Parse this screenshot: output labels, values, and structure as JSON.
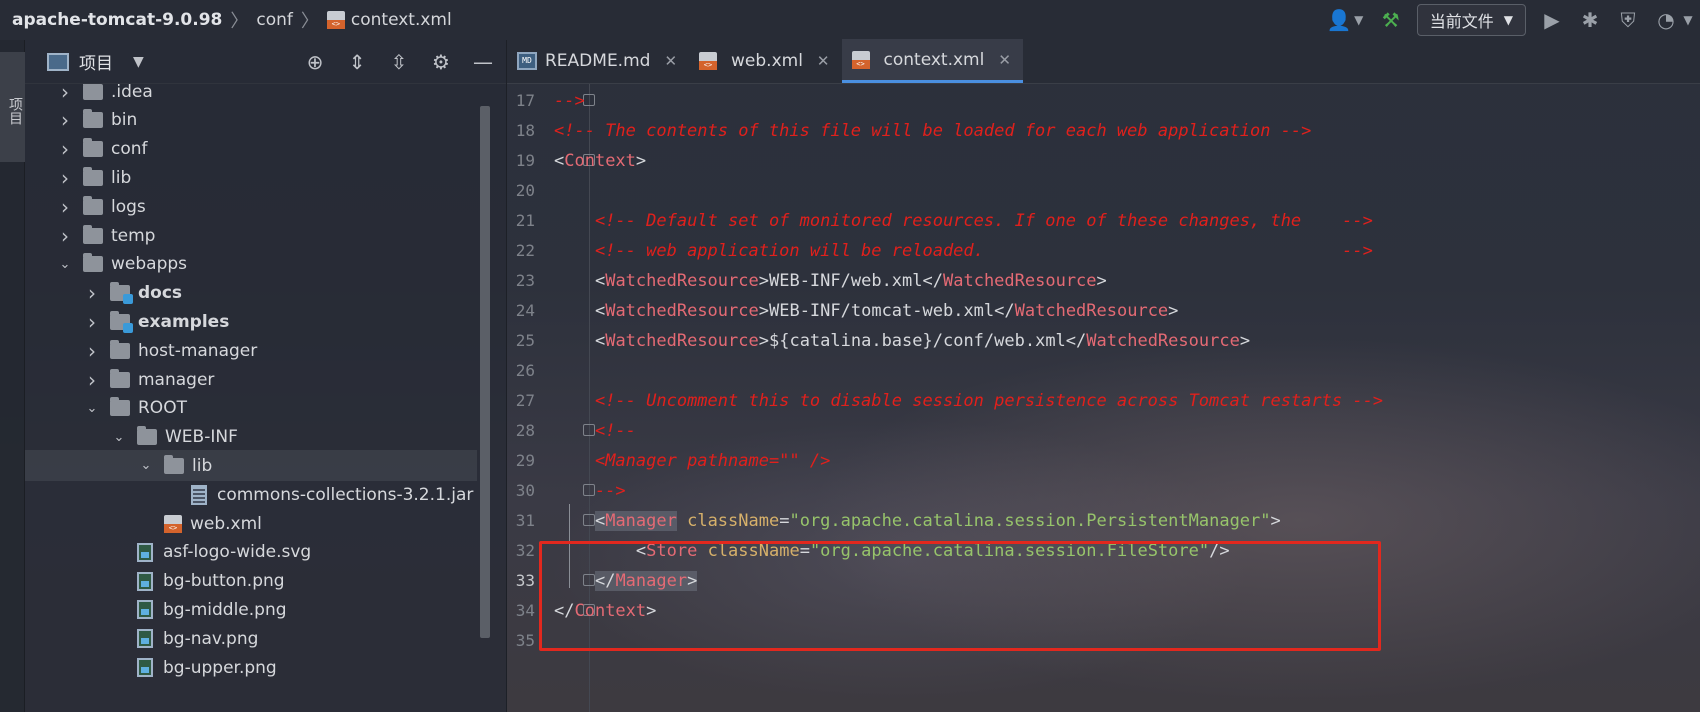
{
  "breadcrumb": {
    "project": "apache-tomcat-9.0.98",
    "folder": "conf",
    "file": "context.xml"
  },
  "toolbar": {
    "run_config": "当前文件",
    "icons": [
      "user-icon",
      "build-hammer-icon",
      "run-icon",
      "debug-icon",
      "coverage-icon",
      "profile-icon"
    ]
  },
  "left_strip": {
    "label": "项目"
  },
  "project_panel": {
    "title": "项目"
  },
  "tree": [
    {
      "label": ".idea",
      "type": "folder",
      "expanded": false,
      "bold": false
    },
    {
      "label": "bin",
      "type": "folder",
      "expanded": false,
      "bold": false
    },
    {
      "label": "conf",
      "type": "folder",
      "expanded": false,
      "bold": false
    },
    {
      "label": "lib",
      "type": "folder",
      "expanded": false,
      "bold": false
    },
    {
      "label": "logs",
      "type": "folder",
      "expanded": false,
      "bold": false
    },
    {
      "label": "temp",
      "type": "folder",
      "expanded": false,
      "bold": false
    },
    {
      "label": "webapps",
      "type": "folder",
      "expanded": true,
      "bold": false
    },
    {
      "label": "docs",
      "type": "module-folder",
      "expanded": false,
      "bold": true
    },
    {
      "label": "examples",
      "type": "module-folder",
      "expanded": false,
      "bold": true
    },
    {
      "label": "host-manager",
      "type": "folder",
      "expanded": false,
      "bold": false
    },
    {
      "label": "manager",
      "type": "folder",
      "expanded": false,
      "bold": false
    },
    {
      "label": "ROOT",
      "type": "folder",
      "expanded": true,
      "bold": false
    },
    {
      "label": "WEB-INF",
      "type": "folder",
      "expanded": true,
      "bold": false
    },
    {
      "label": "lib",
      "type": "folder",
      "expanded": true,
      "bold": false
    },
    {
      "label": "commons-collections-3.2.1.jar",
      "type": "jar",
      "bold": false
    },
    {
      "label": "web.xml",
      "type": "xml",
      "bold": false
    },
    {
      "label": "asf-logo-wide.svg",
      "type": "image",
      "bold": false
    },
    {
      "label": "bg-button.png",
      "type": "image",
      "bold": false
    },
    {
      "label": "bg-middle.png",
      "type": "image",
      "bold": false
    },
    {
      "label": "bg-nav.png",
      "type": "image",
      "bold": false
    },
    {
      "label": "bg-upper.png",
      "type": "image",
      "bold": false
    }
  ],
  "tabs": [
    {
      "label": "README.md",
      "active": false
    },
    {
      "label": "web.xml",
      "active": false
    },
    {
      "label": "context.xml",
      "active": true
    }
  ],
  "code": {
    "current_line": 33,
    "lines": [
      {
        "n": 17,
        "text": "-->"
      },
      {
        "n": 18,
        "text": "<!-- The contents of this file will be loaded for each web application -->"
      },
      {
        "n": 19,
        "text": "<Context>"
      },
      {
        "n": 20,
        "text": ""
      },
      {
        "n": 21,
        "text": "    <!-- Default set of monitored resources. If one of these changes, the    -->"
      },
      {
        "n": 22,
        "text": "    <!-- web application will be reloaded.                                   -->"
      },
      {
        "n": 23,
        "text": "    <WatchedResource>WEB-INF/web.xml</WatchedResource>"
      },
      {
        "n": 24,
        "text": "    <WatchedResource>WEB-INF/tomcat-web.xml</WatchedResource>"
      },
      {
        "n": 25,
        "text": "    <WatchedResource>${catalina.base}/conf/web.xml</WatchedResource>"
      },
      {
        "n": 26,
        "text": ""
      },
      {
        "n": 27,
        "text": "    <!-- Uncomment this to disable session persistence across Tomcat restarts -->"
      },
      {
        "n": 28,
        "text": "    <!--"
      },
      {
        "n": 29,
        "text": "    <Manager pathname=\"\" />"
      },
      {
        "n": 30,
        "text": "    -->"
      },
      {
        "n": 31,
        "text": "    <Manager className=\"org.apache.catalina.session.PersistentManager\">"
      },
      {
        "n": 32,
        "text": "        <Store className=\"org.apache.catalina.session.FileStore\"/>"
      },
      {
        "n": 33,
        "text": "    </Manager>"
      },
      {
        "n": 34,
        "text": "</Context>"
      },
      {
        "n": 35,
        "text": ""
      }
    ]
  },
  "colors": {
    "comment": "#e0201c",
    "tag": "#e46a74",
    "attribute": "#d6b06a",
    "string": "#97c46b",
    "highlight_box": "#e2281e",
    "active_tab_underline": "#4a8fe0"
  }
}
